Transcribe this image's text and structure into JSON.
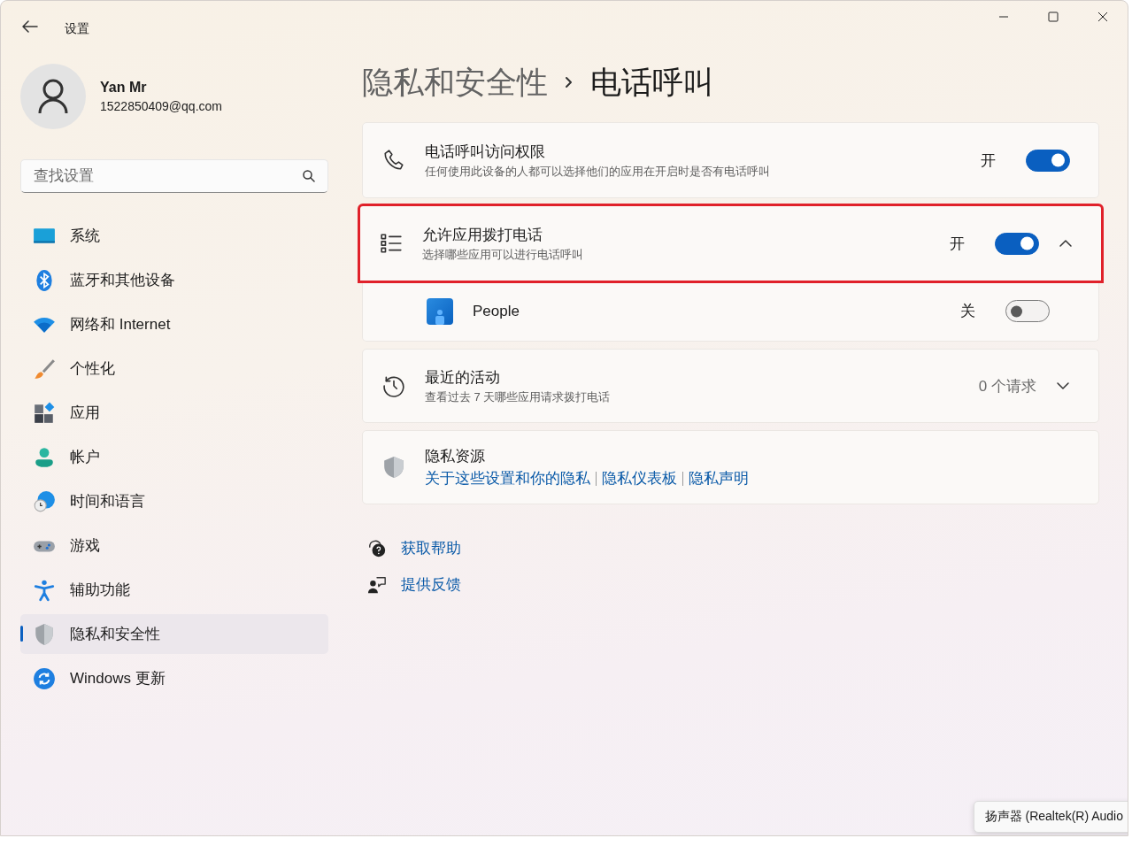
{
  "window": {
    "title": "设置"
  },
  "user": {
    "name": "Yan Mr",
    "email": "1522850409@qq.com"
  },
  "search": {
    "placeholder": "查找设置"
  },
  "nav": [
    {
      "label": "系统",
      "selected": false
    },
    {
      "label": "蓝牙和其他设备",
      "selected": false
    },
    {
      "label": "网络和 Internet",
      "selected": false
    },
    {
      "label": "个性化",
      "selected": false
    },
    {
      "label": "应用",
      "selected": false
    },
    {
      "label": "帐户",
      "selected": false
    },
    {
      "label": "时间和语言",
      "selected": false
    },
    {
      "label": "游戏",
      "selected": false
    },
    {
      "label": "辅助功能",
      "selected": false
    },
    {
      "label": "隐私和安全性",
      "selected": true
    },
    {
      "label": "Windows 更新",
      "selected": false
    }
  ],
  "breadcrumb": {
    "parent": "隐私和安全性",
    "current": "电话呼叫"
  },
  "settings": [
    {
      "kind": "toggle",
      "title": "电话呼叫访问权限",
      "description": "任何使用此设备的人都可以选择他们的应用在开启时是否有电话呼叫",
      "state_label": "开",
      "on": true,
      "highlighted": false
    },
    {
      "kind": "expander",
      "title": "允许应用拨打电话",
      "description": "选择哪些应用可以进行电话呼叫",
      "state_label": "开",
      "on": true,
      "expanded": true,
      "highlighted": true,
      "children": [
        {
          "name": "People",
          "state_label": "关",
          "on": false
        }
      ]
    },
    {
      "kind": "activity",
      "title": "最近的活动",
      "description": "查看过去 7 天哪些应用请求拨打电话",
      "value": "0 个请求",
      "expanded": false
    },
    {
      "kind": "links",
      "title": "隐私资源",
      "links": [
        "关于这些设置和你的隐私",
        "隐私仪表板",
        "隐私声明"
      ]
    }
  ],
  "help_links": [
    {
      "label": "获取帮助"
    },
    {
      "label": "提供反馈"
    }
  ],
  "tooltip": {
    "text": "扬声器 (Realtek(R) Audio"
  }
}
